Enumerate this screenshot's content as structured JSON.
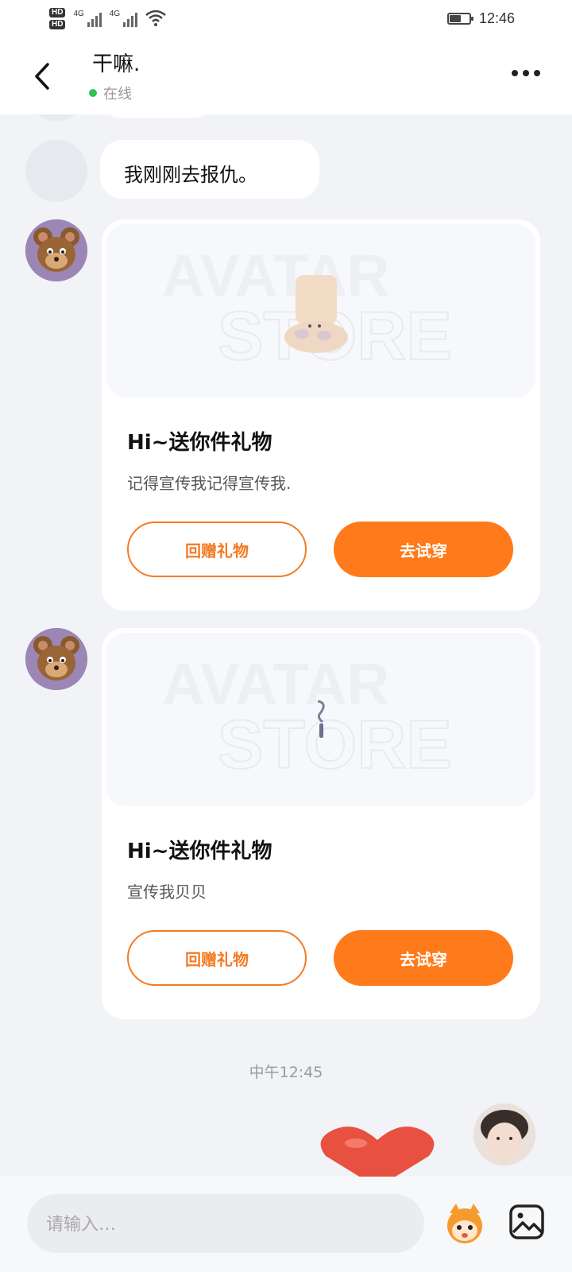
{
  "status_bar": {
    "hd1": "HD",
    "hd2": "HD",
    "signal1": "4G",
    "signal2": "4G",
    "time": "12:46"
  },
  "header": {
    "title": "干嘛.",
    "status": "在线"
  },
  "messages": {
    "text_bubble": "我刚刚去报仇。",
    "gift_cards": [
      {
        "title": "Hi~送你件礼物",
        "message": "记得宣传我记得宣传我.",
        "return_label": "回赠礼物",
        "try_label": "去试穿"
      },
      {
        "title": "Hi~送你件礼物",
        "message": "宣传我贝贝",
        "return_label": "回赠礼物",
        "try_label": "去试穿"
      }
    ],
    "timestamp": "中午12:45"
  },
  "input_bar": {
    "placeholder": "请输入…"
  },
  "colors": {
    "accent": "#ff7a1a",
    "online": "#2ec35a",
    "background": "#f1f3f7"
  }
}
